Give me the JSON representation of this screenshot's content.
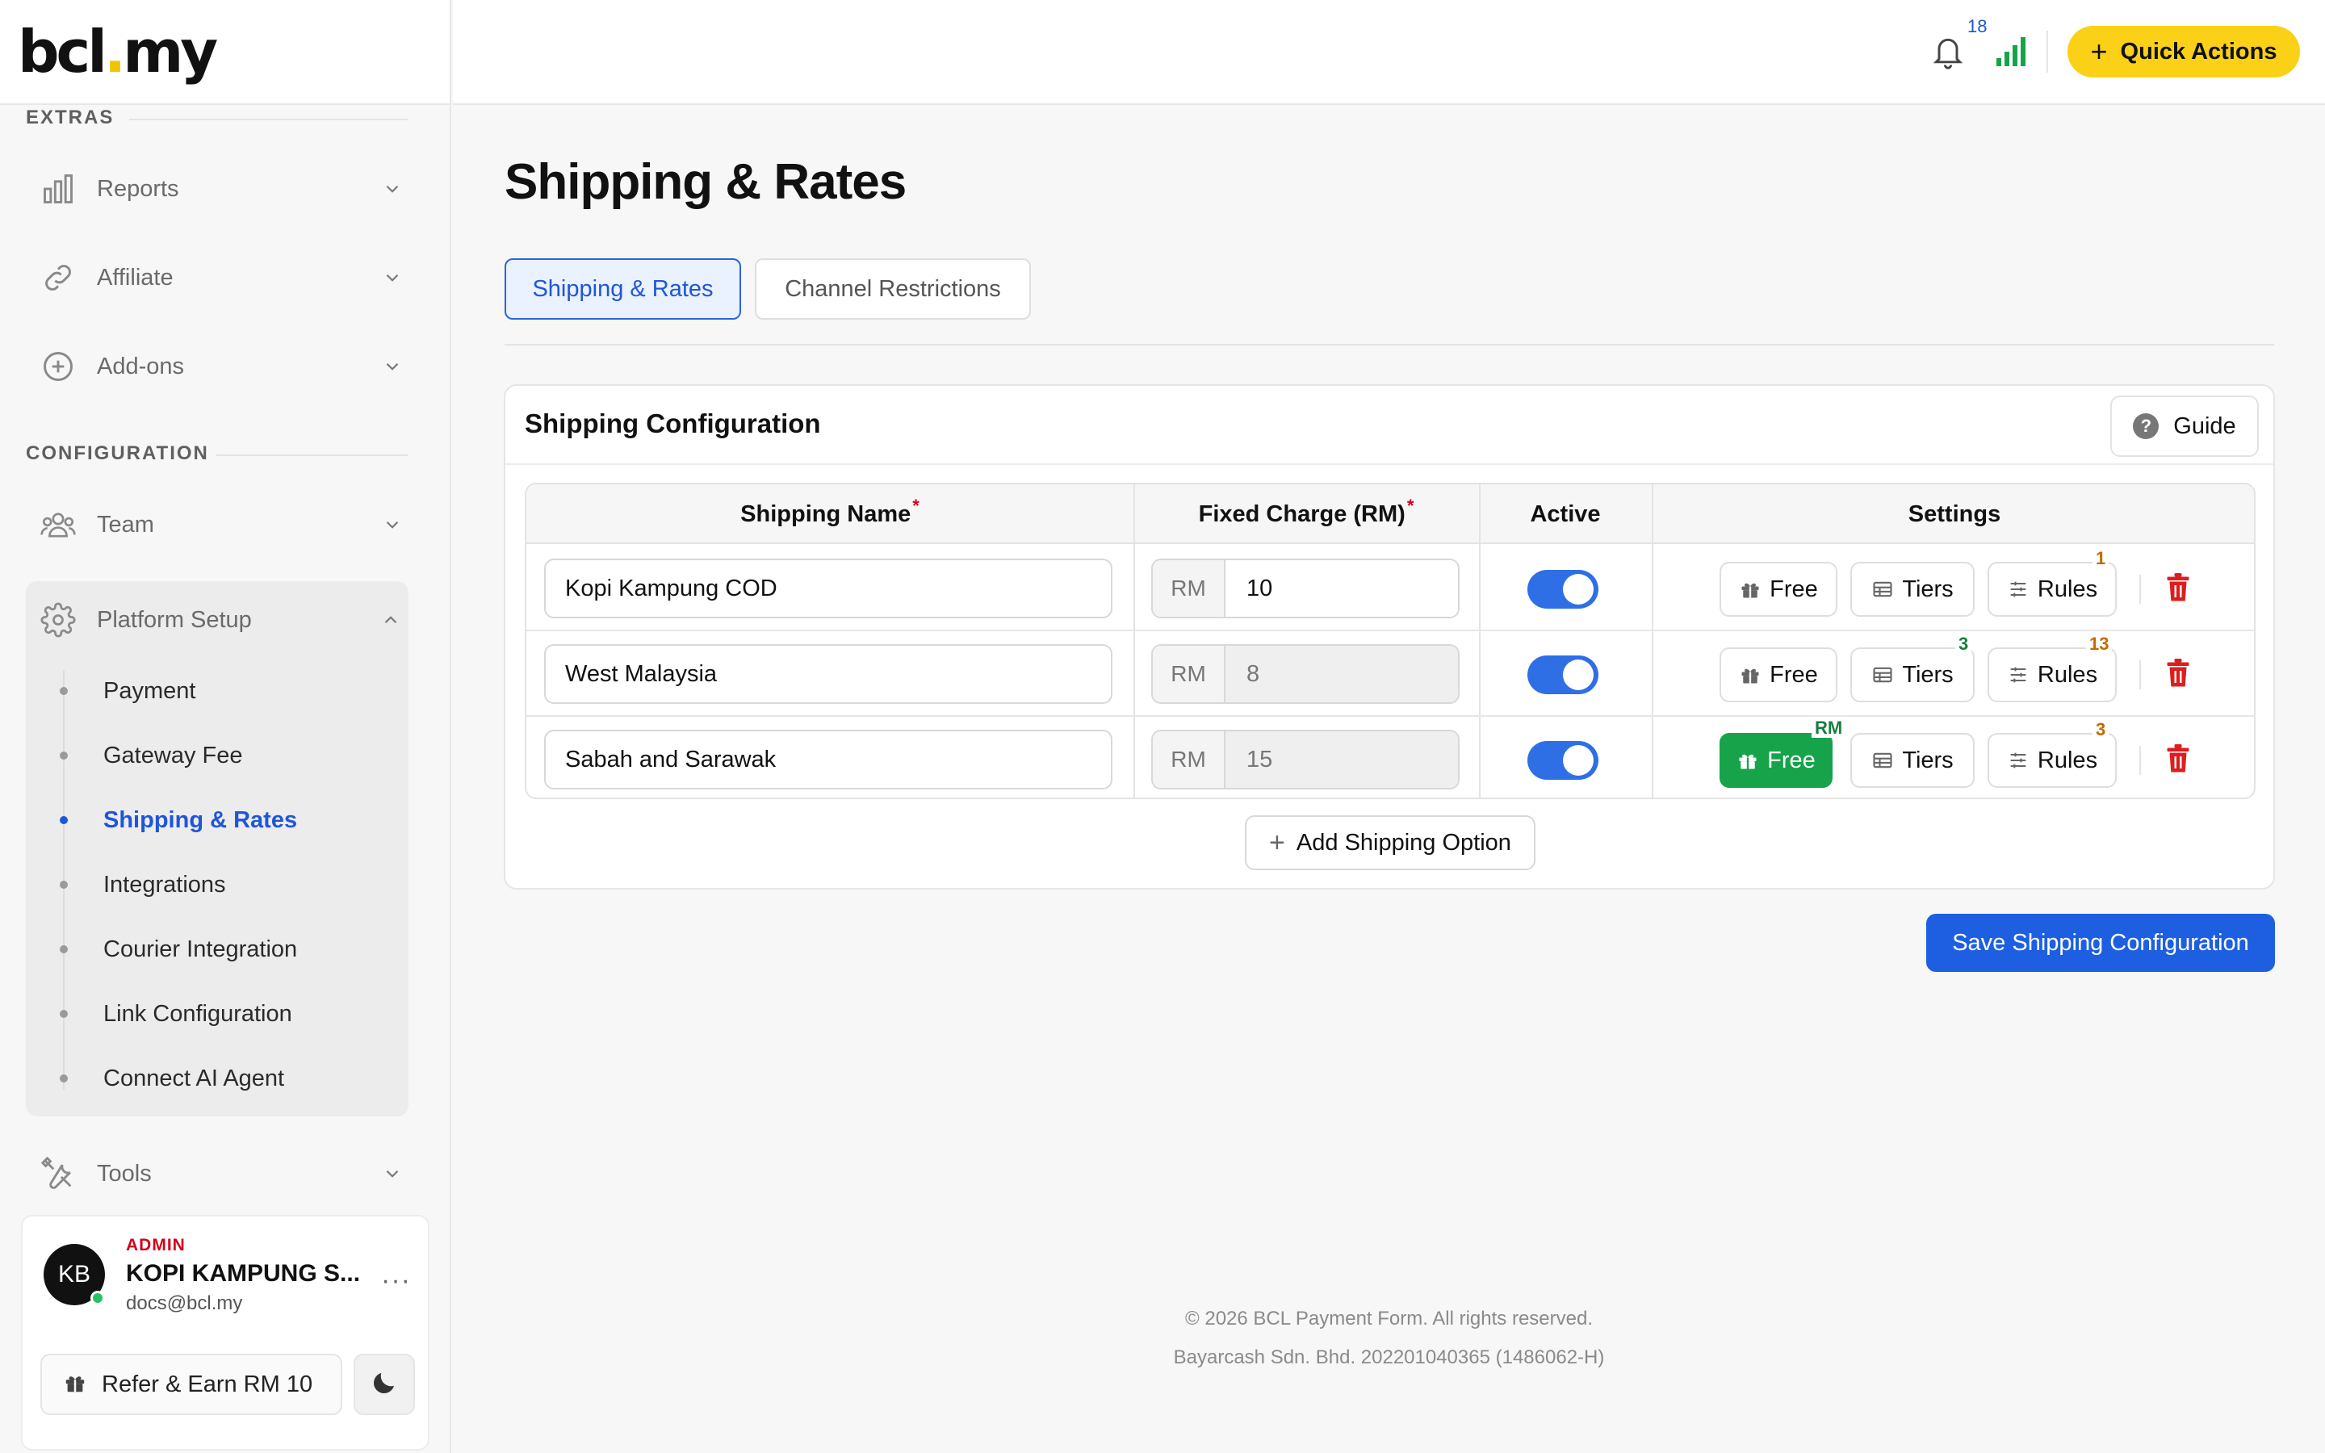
{
  "brand": {
    "logo_left": "bcl",
    "logo_dot": ".",
    "logo_right": "my"
  },
  "sidebar": {
    "extras_label": "EXTRAS",
    "config_label": "CONFIGURATION",
    "extras": [
      {
        "label": "Reports",
        "icon": "bar-chart-icon"
      },
      {
        "label": "Affiliate",
        "icon": "link-icon"
      },
      {
        "label": "Add-ons",
        "icon": "plus-circle-icon"
      }
    ],
    "team": {
      "label": "Team",
      "icon": "users-icon"
    },
    "platform_setup": {
      "label": "Platform Setup",
      "icon": "gear-icon",
      "items": [
        {
          "label": "Payment"
        },
        {
          "label": "Gateway Fee"
        },
        {
          "label": "Shipping & Rates",
          "active": true
        },
        {
          "label": "Integrations"
        },
        {
          "label": "Courier Integration"
        },
        {
          "label": "Link Configuration"
        },
        {
          "label": "Connect AI Agent"
        }
      ]
    },
    "tools": {
      "label": "Tools",
      "icon": "tools-icon"
    },
    "user": {
      "initials": "KB",
      "role": "ADMIN",
      "name": "KOPI KAMPUNG S...",
      "email": "docs@bcl.my",
      "more": "···",
      "refer_label": "Refer & Earn RM 10"
    }
  },
  "header": {
    "notification_count": "18",
    "quick_actions_label": "Quick Actions",
    "quick_actions_plus": "+",
    "accent": "#fbd117"
  },
  "main": {
    "title": "Shipping & Rates",
    "tabs": [
      {
        "label": "Shipping & Rates",
        "active": true
      },
      {
        "label": "Channel Restrictions",
        "active": false
      }
    ],
    "card": {
      "title": "Shipping Configuration",
      "guide_label": "Guide",
      "guide_icon_text": "?",
      "columns": {
        "name": "Shipping Name",
        "charge": "Fixed Charge (RM)",
        "active": "Active",
        "settings": "Settings",
        "required_mark": "*"
      },
      "rows": [
        {
          "name": "Kopi Kampung COD",
          "unit": "RM",
          "charge": "10",
          "active": true,
          "free_label": "Free",
          "tiers_label": "Tiers",
          "rules_label": "Rules",
          "free_badge": "",
          "tiers_badge": "",
          "rules_badge": "1",
          "free_enabled": false
        },
        {
          "name": "West Malaysia",
          "unit": "RM",
          "charge": "8",
          "active": true,
          "free_label": "Free",
          "tiers_label": "Tiers",
          "rules_label": "Rules",
          "free_badge": "",
          "tiers_badge": "3",
          "rules_badge": "13",
          "free_enabled": false
        },
        {
          "name": "Sabah and Sarawak",
          "unit": "RM",
          "charge": "15",
          "active": true,
          "free_label": "Free",
          "tiers_label": "Tiers",
          "rules_label": "Rules",
          "free_badge": "RM",
          "tiers_badge": "",
          "rules_badge": "3",
          "free_enabled": true
        }
      ],
      "add_label": "Add Shipping Option",
      "add_plus": "+"
    },
    "save_label": "Save Shipping Configuration",
    "primary_color": "#1d5fe0",
    "success_color": "#16a34a"
  },
  "footer": {
    "line1": "© 2026 BCL Payment Form. All rights reserved.",
    "line2": "Bayarcash Sdn. Bhd. 202201040365 (1486062-H)"
  }
}
